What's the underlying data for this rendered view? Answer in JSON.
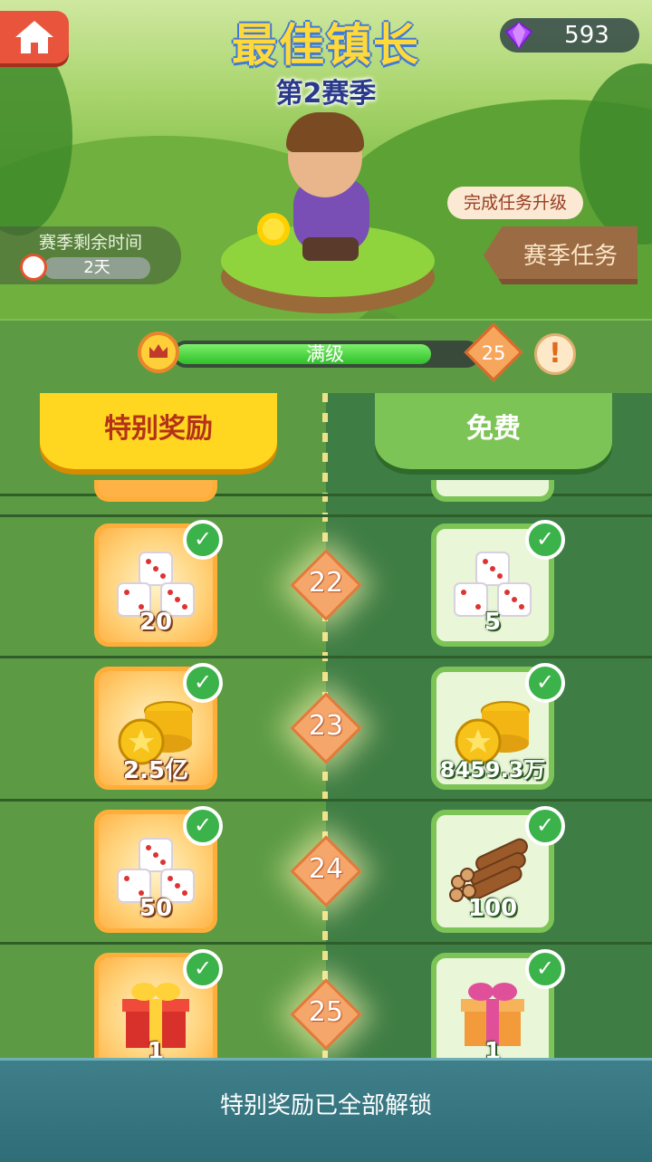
{
  "header": {
    "title": "最佳镇长",
    "subtitle": "第2赛季",
    "gems": "593"
  },
  "season": {
    "remaining_label": "赛季剩余时间",
    "remaining_value": "2天",
    "task_tip": "完成任务升级",
    "task_button": "赛季任务"
  },
  "progress": {
    "label": "满级",
    "level": "25",
    "fill_fraction": 1.0
  },
  "columns": {
    "special": "特别奖励",
    "free": "免费"
  },
  "rewards": [
    {
      "level": "22",
      "special": {
        "icon": "dice-icon",
        "qty": "20"
      },
      "free": {
        "icon": "dice-icon",
        "qty": "5"
      }
    },
    {
      "level": "23",
      "special": {
        "icon": "gold-coins-icon",
        "qty": "2.5亿"
      },
      "free": {
        "icon": "gold-coins-icon",
        "qty": "8459.3万"
      }
    },
    {
      "level": "24",
      "special": {
        "icon": "dice-icon",
        "qty": "50"
      },
      "free": {
        "icon": "wood-logs-icon",
        "qty": "100"
      }
    },
    {
      "level": "25",
      "special": {
        "icon": "gift-box-icon",
        "qty": "1"
      },
      "free": {
        "icon": "gift-box-icon",
        "qty": "1"
      }
    }
  ],
  "footer": {
    "text": "特别奖励已全部解锁"
  },
  "colors": {
    "special_header": "#ffd620",
    "free_header": "#7cc456",
    "claimed_check": "#3bb24a"
  }
}
